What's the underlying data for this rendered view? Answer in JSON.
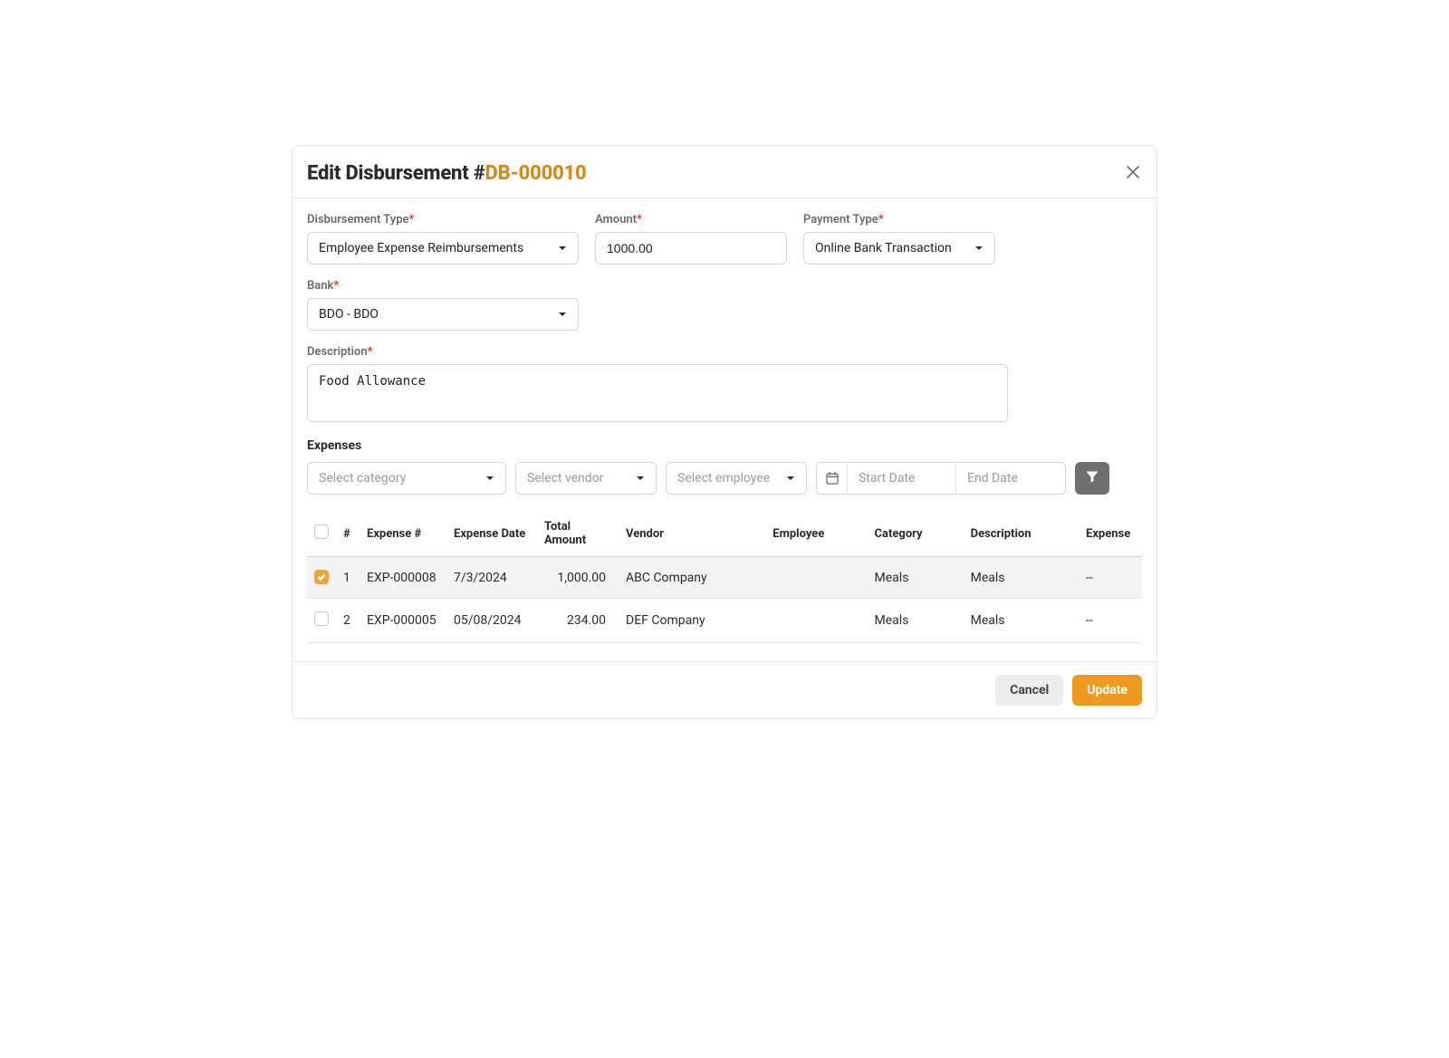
{
  "dialog": {
    "title_prefix": "Edit Disbursement #",
    "disbursement_id": "DB-000010"
  },
  "fields": {
    "disbursement_type": {
      "label": "Disbursement Type",
      "value": "Employee Expense Reimbursements"
    },
    "amount": {
      "label": "Amount",
      "value": "1000.00"
    },
    "payment_type": {
      "label": "Payment Type",
      "value": "Online Bank Transaction"
    },
    "bank": {
      "label": "Bank",
      "value": "BDO - BDO"
    },
    "description": {
      "label": "Description",
      "value": "Food Allowance"
    }
  },
  "expenses_section": {
    "label": "Expenses",
    "filters": {
      "category_placeholder": "Select category",
      "vendor_placeholder": "Select vendor",
      "employee_placeholder": "Select employee",
      "start_date_placeholder": "Start Date",
      "end_date_placeholder": "End Date"
    },
    "columns": {
      "num": "#",
      "expense_num": "Expense #",
      "expense_date": "Expense Date",
      "total_amount": "Total Amount",
      "vendor": "Vendor",
      "employee": "Employee",
      "category": "Category",
      "description": "Description",
      "expense": "Expense"
    },
    "rows": [
      {
        "selected": true,
        "num": "1",
        "expense_num": "EXP-000008",
        "date": "7/3/2024",
        "amount": "1,000.00",
        "vendor": "ABC Company",
        "employee": "",
        "category": "Meals",
        "description": "Meals",
        "expense": "--"
      },
      {
        "selected": false,
        "num": "2",
        "expense_num": "EXP-000005",
        "date": "05/08/2024",
        "amount": "234.00",
        "vendor": "DEF Company",
        "employee": "",
        "category": "Meals",
        "description": "Meals",
        "expense": "--"
      }
    ]
  },
  "footer": {
    "cancel": "Cancel",
    "update": "Update"
  }
}
